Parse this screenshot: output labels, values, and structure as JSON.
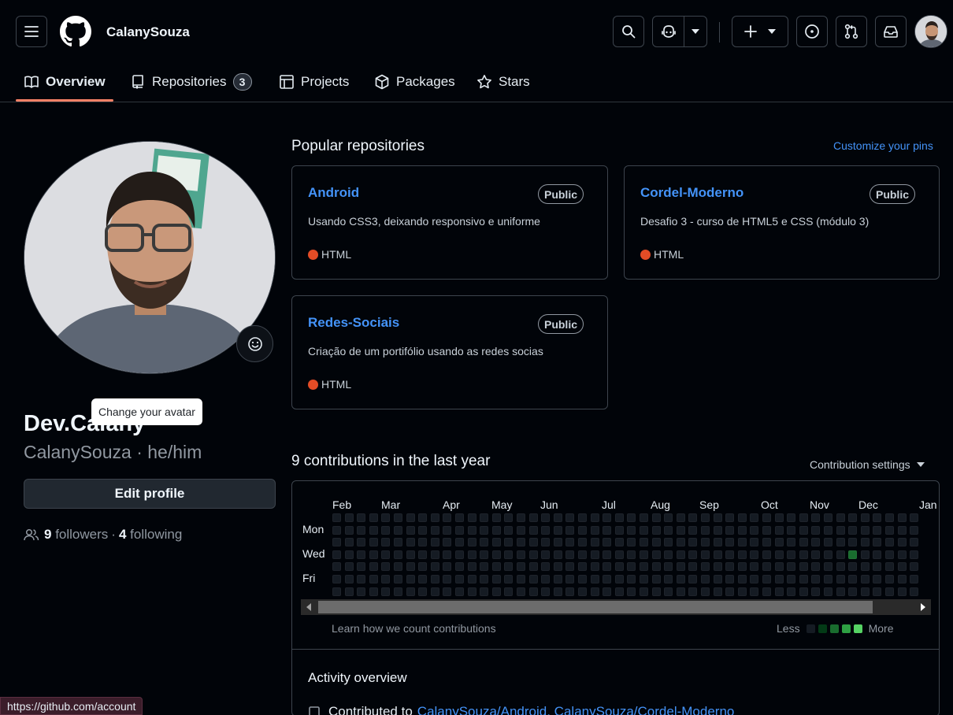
{
  "header": {
    "username": "CalanySouza"
  },
  "tabs": [
    {
      "label": "Overview"
    },
    {
      "label": "Repositories",
      "count": "3"
    },
    {
      "label": "Projects"
    },
    {
      "label": "Packages"
    },
    {
      "label": "Stars"
    }
  ],
  "profile": {
    "tooltip": "Change your avatar",
    "display_name": "Dev.Calany",
    "handle": "CalanySouza · he/him",
    "edit_label": "Edit profile",
    "followers_count": "9",
    "followers_label": "followers",
    "dot": "·",
    "following_count": "4",
    "following_label": "following"
  },
  "popular": {
    "title": "Popular repositories",
    "customize": "Customize your pins",
    "repos": [
      {
        "name": "Android",
        "visibility": "Public",
        "description": "Usando CSS3, deixando responsivo e uniforme",
        "language": "HTML"
      },
      {
        "name": "Cordel-Moderno",
        "visibility": "Public",
        "description": "Desafio 3 - curso de HTML5 e CSS (módulo 3)",
        "language": "HTML"
      },
      {
        "name": "Redes-Sociais",
        "visibility": "Public",
        "description": "Criação de um portifólio usando as redes socias",
        "language": "HTML"
      }
    ]
  },
  "contributions": {
    "title": "9 contributions in the last year",
    "settings": "Contribution settings",
    "months": [
      "Feb",
      "Mar",
      "Apr",
      "May",
      "Jun",
      "Jul",
      "Aug",
      "Sep",
      "Oct",
      "Nov",
      "Dec",
      "Jan"
    ],
    "days": [
      "Mon",
      "Wed",
      "Fri"
    ],
    "learn": "Learn how we count contributions",
    "less": "Less",
    "more": "More",
    "legend_colors": [
      "#151b23",
      "#033a16",
      "#196c2e",
      "#2ea043",
      "#56d364"
    ],
    "cell_color": "#151b23",
    "active_color": "#196c2e"
  },
  "activity": {
    "title": "Activity overview",
    "contributed_to": "Contributed to",
    "repos_text": "CalanySouza/Android, CalanySouza/Cordel-Moderno"
  },
  "status_url": "https://github.com/account"
}
